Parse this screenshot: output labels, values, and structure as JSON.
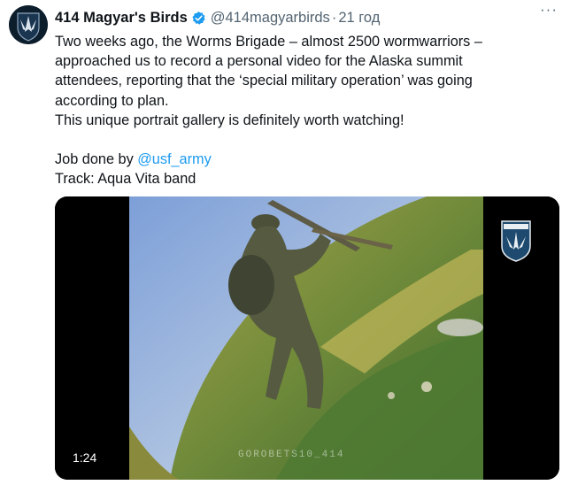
{
  "author": {
    "display_name": "414 Magyar's Birds",
    "handle": "@414magyarbirds",
    "separator": "·",
    "timestamp": "21 год",
    "verified": true,
    "avatar_icon": "shield-emblem-icon"
  },
  "tweet": {
    "lines": [
      "Two weeks ago, the Worms Brigade – almost 2500 wormwarriors –",
      "approached us to record a personal video for the Alaska summit",
      "attendees, reporting that the ‘special military operation’ was going",
      "according to plan.",
      "This unique portrait gallery is definitely worth watching!"
    ],
    "credit_prefix": "Job done by ",
    "credit_mention": "@usf_army",
    "track": "Track: Aqua Vita band"
  },
  "media": {
    "type": "video",
    "duration": "1:24",
    "overlay_caption": "GOROBETS10_414",
    "badge_icon": "unit-shield-icon"
  },
  "colors": {
    "link": "#1d9bf0",
    "verified": "#1d9bf0",
    "secondary_text": "#536471"
  },
  "menu_icon": "more-dots-icon"
}
